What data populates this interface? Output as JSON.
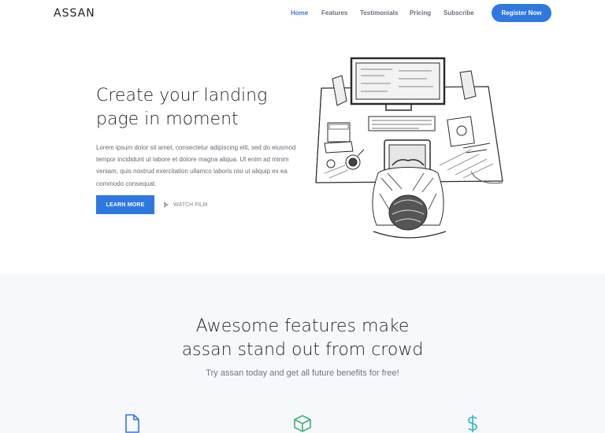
{
  "nav": {
    "logo": "ASSAN",
    "items": [
      "Home",
      "Features",
      "Testimonials",
      "Pricing",
      "Subscribe"
    ],
    "active": "Home",
    "register_label": "Register Now"
  },
  "hero": {
    "title_line1": "Create your landing",
    "title_line2": "page in moment",
    "text": "Lorem ipsum dolor sit amet, consectetur adipiscing elit, sed do eiusmod tempor incididunt ut labore et dolore magna aliqua. Ut enim ad minim veniam, quis nostrud exercitation ullamco laboris nisi ut aliquip ex ea commodo consequat.",
    "learn_label": "LEARN MORE",
    "watch_label": "WATCH FILM"
  },
  "features": {
    "title_line1": "Awesome features make",
    "title_line2": "assan stand out from crowd",
    "subtitle": "Try assan today and get all future benefits for free!",
    "icons": [
      "document-icon",
      "box-icon",
      "dollar-icon"
    ]
  },
  "colors": {
    "accent": "#2f78e0",
    "features_bg": "#f6f8fc",
    "box_icon": "#3cb371",
    "dollar_icon": "#2ab7c9"
  }
}
